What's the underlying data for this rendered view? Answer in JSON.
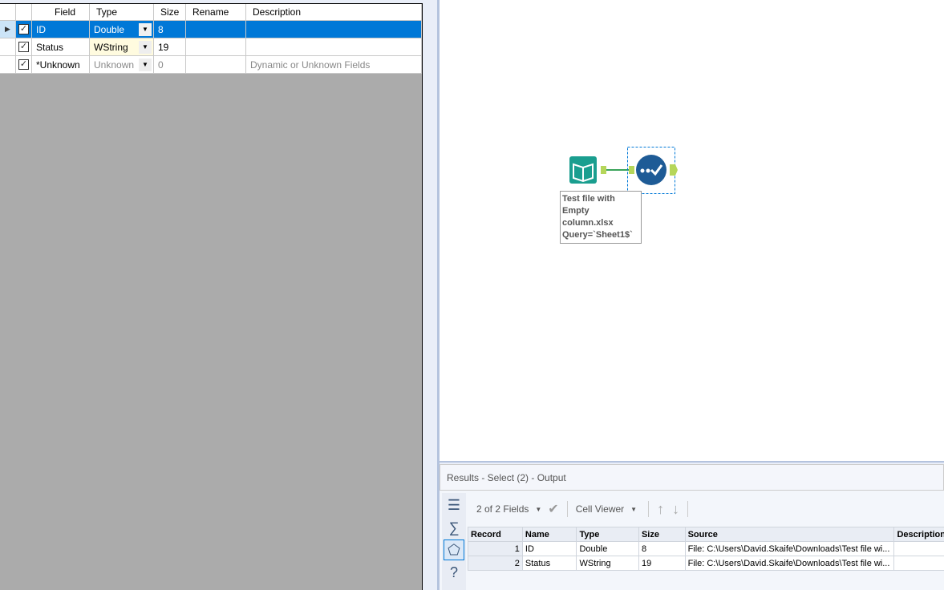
{
  "config_grid": {
    "headers": [
      "Field",
      "Type",
      "Size",
      "Rename",
      "Description"
    ],
    "rows": [
      {
        "field": "ID",
        "type": "Double",
        "size": "8",
        "rename": "",
        "description": "",
        "checked": true,
        "selected": true
      },
      {
        "field": "Status",
        "type": "WString",
        "size": "19",
        "rename": "",
        "description": "",
        "checked": true
      },
      {
        "field": "*Unknown",
        "type": "Unknown",
        "size": "0",
        "rename": "",
        "description": "Dynamic or Unknown Fields",
        "checked": true
      }
    ]
  },
  "canvas": {
    "input_annotation": "Test file with Empty column.xlsx Query=`Sheet1$`"
  },
  "results": {
    "title": "Results - Select (2) - Output",
    "fields_label": "2 of 2 Fields",
    "cell_viewer_label": "Cell Viewer",
    "headers": [
      "Record",
      "Name",
      "Type",
      "Size",
      "Source",
      "Description"
    ],
    "rows": [
      {
        "record": "1",
        "name": "ID",
        "type": "Double",
        "size": "8",
        "source": "File: C:\\Users\\David.Skaife\\Downloads\\Test file wi...",
        "description": ""
      },
      {
        "record": "2",
        "name": "Status",
        "type": "WString",
        "size": "19",
        "source": "File: C:\\Users\\David.Skaife\\Downloads\\Test file wi...",
        "description": ""
      }
    ]
  }
}
